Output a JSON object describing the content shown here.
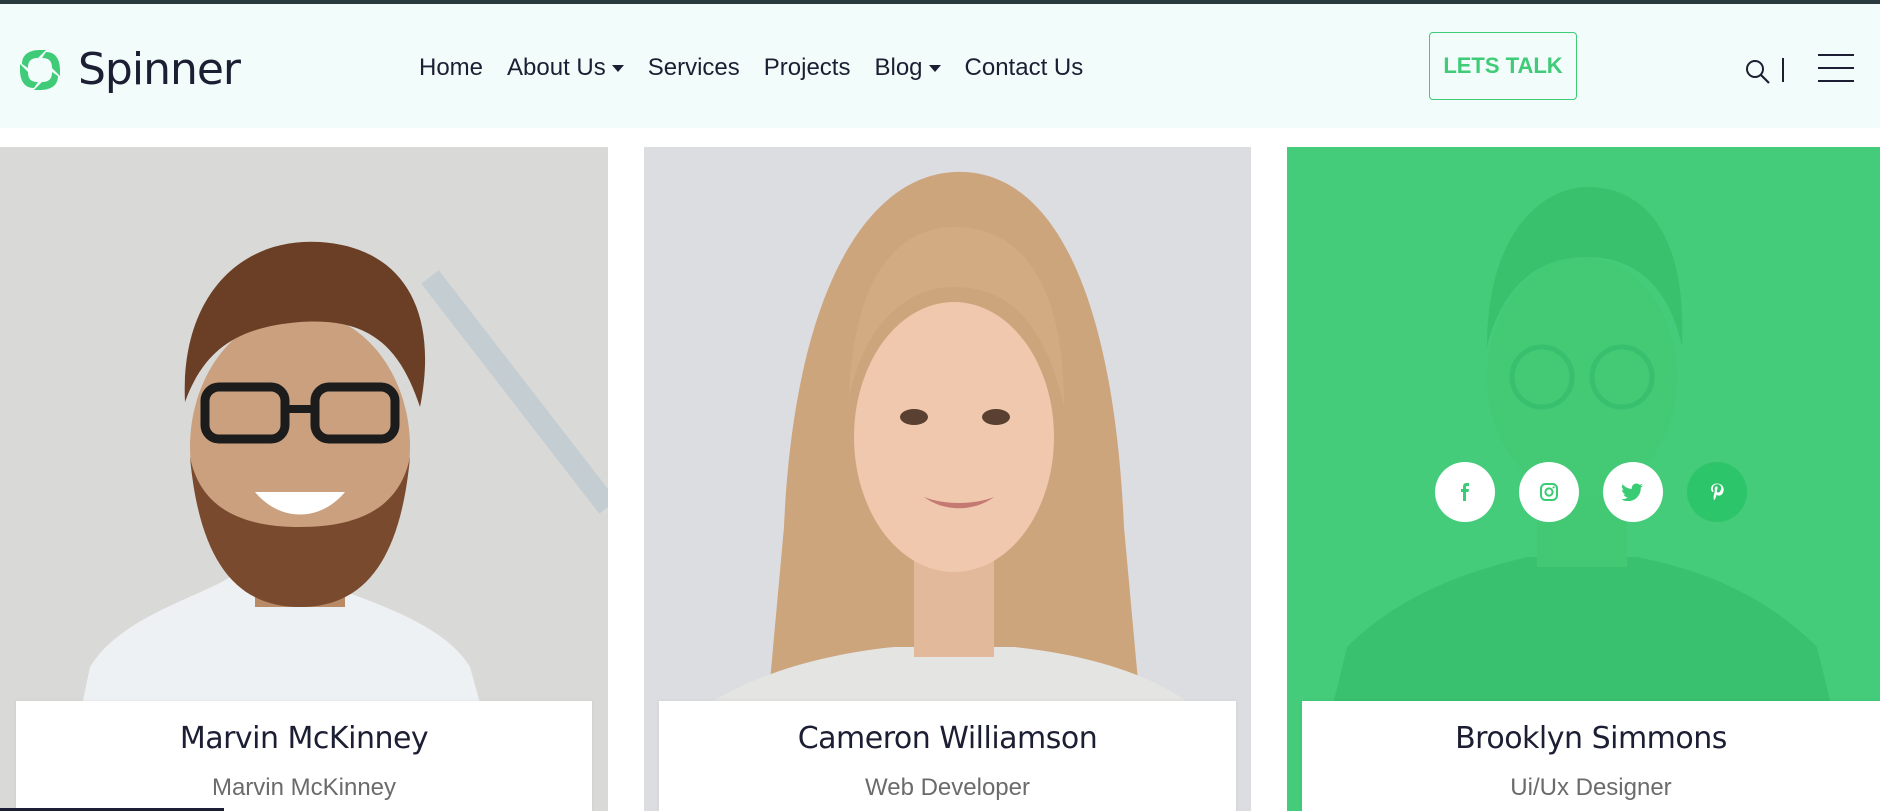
{
  "brand": {
    "name": "Spinner",
    "accent": "#3fcb77"
  },
  "nav": [
    {
      "label": "Home",
      "dropdown": false
    },
    {
      "label": "About Us",
      "dropdown": true
    },
    {
      "label": "Services",
      "dropdown": false
    },
    {
      "label": "Projects",
      "dropdown": false
    },
    {
      "label": "Blog",
      "dropdown": true
    },
    {
      "label": "Contact Us",
      "dropdown": false
    }
  ],
  "header": {
    "cta_label": "LETS TALK",
    "search_icon": "search-icon",
    "menu_icon": "hamburger-menu-icon"
  },
  "team": [
    {
      "name": "Marvin McKinney",
      "role": "Marvin McKinney"
    },
    {
      "name": "Cameron Williamson",
      "role": "Web Developer"
    },
    {
      "name": "Brooklyn Simmons",
      "role": "Ui/Ux Designer"
    }
  ],
  "socials": [
    "facebook-icon",
    "instagram-icon",
    "twitter-icon",
    "pinterest-icon"
  ]
}
